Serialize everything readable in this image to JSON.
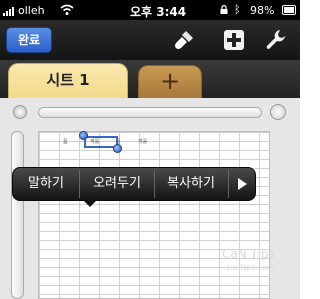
{
  "status": {
    "carrier": "olleh",
    "time": "오후 3:44",
    "battery": "98%"
  },
  "toolbar": {
    "done_label": "완료"
  },
  "tabs": {
    "active_label": "시트 1",
    "add_label": "+"
  },
  "cells": [
    "품",
    "계률",
    "품",
    "개률"
  ],
  "menu": {
    "items": [
      "말하기",
      "오려두기",
      "복사하기"
    ]
  },
  "watermark": {
    "title": "CaN Tips",
    "sub": "cantips.com"
  },
  "colors": {
    "accent": "#3569c7",
    "tab_active": "#f3d98a",
    "tab_add": "#b6853f"
  },
  "icons": [
    "signal-icon",
    "wifi-icon",
    "lock-icon",
    "bluetooth-icon",
    "battery-icon",
    "paintbrush-icon",
    "add-icon",
    "wrench-icon",
    "more-arrow-icon"
  ]
}
